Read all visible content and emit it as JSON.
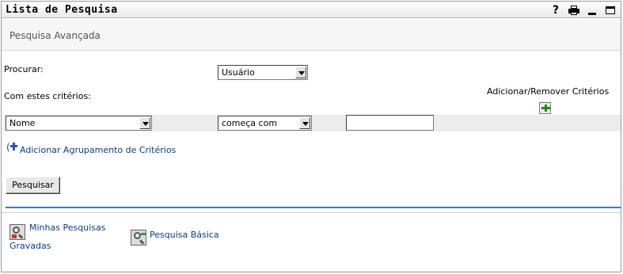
{
  "titlebar": {
    "title": "Lista de Pesquisa",
    "icons": [
      "help-icon",
      "print-icon",
      "minimize-icon",
      "maximize-icon"
    ],
    "help_glyph": "?"
  },
  "subheader": {
    "label": "Pesquisa Avançada"
  },
  "form": {
    "search_for_label": "Procurar:",
    "search_for_value": "Usuário",
    "criteria_label": "Com estes critérios:",
    "add_remove_label": "Adicionar/Remover Critérios",
    "attribute_value": "Nome",
    "operator_value": "começa com",
    "text_value": "",
    "add_group_link": "Adicionar Agrupamento de Critérios",
    "search_button": "Pesquisar"
  },
  "footer": {
    "saved_searches_line1": "Minhas Pesquisas",
    "saved_searches_line2": "Gravadas",
    "basic_search": "Pesquisa Básica"
  },
  "colors": {
    "link": "#0d3a87",
    "separator": "#4a78b4",
    "plus": "#1c8a1c"
  }
}
